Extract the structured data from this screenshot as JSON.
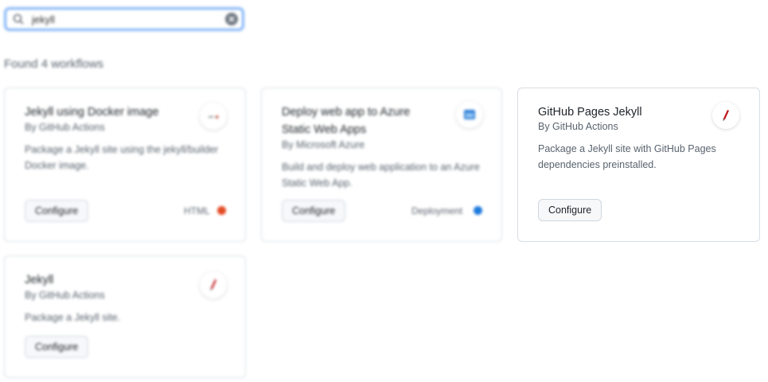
{
  "search": {
    "query": "jekyll"
  },
  "results": {
    "found_text": "Found 4 workflows"
  },
  "cards": [
    {
      "title": "Jekyll using Docker image",
      "author": "By GitHub Actions",
      "description": "Package a Jekyll site using the jekyll/builder Docker image.",
      "button": "Configure",
      "category": "HTML",
      "category_color": "#e34c26",
      "icon": "docker-icon"
    },
    {
      "title_line1": "Deploy web app to Azure",
      "title_line2": "Static Web Apps",
      "author": "By Microsoft Azure",
      "description_line1": "Build and deploy web application to an Azure",
      "description_line2": "Static Web App.",
      "button": "Configure",
      "category": "Deployment",
      "category_color": "#0969da",
      "icon": "azure-icon"
    },
    {
      "title": "GitHub Pages Jekyll",
      "author": "By GitHub Actions",
      "description_line1": "Package a Jekyll site with GitHub Pages",
      "description_line2": "dependencies preinstalled.",
      "button": "Configure",
      "icon": "jekyll-icon"
    },
    {
      "title": "Jekyll",
      "author": "By GitHub Actions",
      "description": "Package a Jekyll site.",
      "button": "Configure",
      "icon": "jekyll-icon"
    }
  ]
}
